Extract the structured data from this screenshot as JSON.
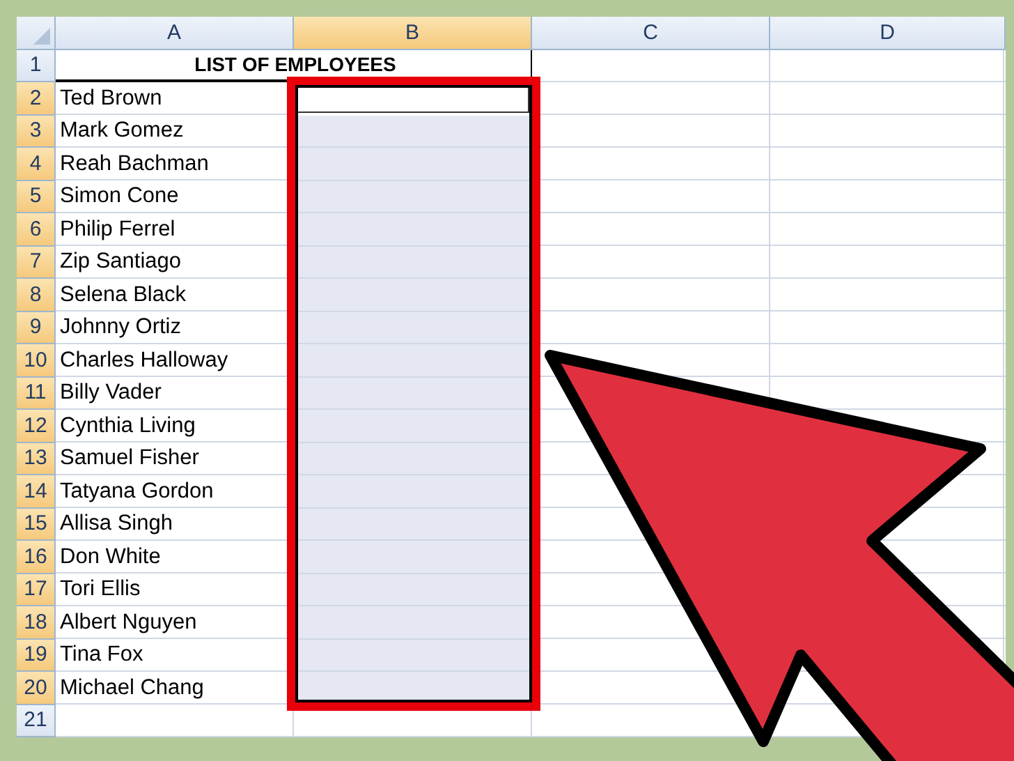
{
  "sheet": {
    "columns": [
      {
        "label": "A",
        "selected": false
      },
      {
        "label": "B",
        "selected": true
      },
      {
        "label": "C",
        "selected": false
      },
      {
        "label": "D",
        "selected": false
      }
    ],
    "rows": [
      {
        "label": "1",
        "kind": "title",
        "selected": false,
        "active": false,
        "text": "LIST OF EMPLOYEES"
      },
      {
        "label": "2",
        "kind": "name",
        "selected": true,
        "active": true,
        "text": "Ted Brown"
      },
      {
        "label": "3",
        "kind": "name",
        "selected": true,
        "active": false,
        "text": "Mark Gomez"
      },
      {
        "label": "4",
        "kind": "name",
        "selected": true,
        "active": false,
        "text": "Reah Bachman"
      },
      {
        "label": "5",
        "kind": "name",
        "selected": true,
        "active": false,
        "text": "Simon Cone"
      },
      {
        "label": "6",
        "kind": "name",
        "selected": true,
        "active": false,
        "text": "Philip Ferrel"
      },
      {
        "label": "7",
        "kind": "name",
        "selected": true,
        "active": false,
        "text": "Zip Santiago"
      },
      {
        "label": "8",
        "kind": "name",
        "selected": true,
        "active": false,
        "text": "Selena Black"
      },
      {
        "label": "9",
        "kind": "name",
        "selected": true,
        "active": false,
        "text": "Johnny Ortiz"
      },
      {
        "label": "10",
        "kind": "name",
        "selected": true,
        "active": false,
        "text": "Charles Halloway"
      },
      {
        "label": "11",
        "kind": "name",
        "selected": true,
        "active": false,
        "text": "Billy Vader"
      },
      {
        "label": "12",
        "kind": "name",
        "selected": true,
        "active": false,
        "text": "Cynthia Living"
      },
      {
        "label": "13",
        "kind": "name",
        "selected": true,
        "active": false,
        "text": "Samuel Fisher"
      },
      {
        "label": "14",
        "kind": "name",
        "selected": true,
        "active": false,
        "text": "Tatyana Gordon"
      },
      {
        "label": "15",
        "kind": "name",
        "selected": true,
        "active": false,
        "text": "Allisa Singh"
      },
      {
        "label": "16",
        "kind": "name",
        "selected": true,
        "active": false,
        "text": "Don White"
      },
      {
        "label": "17",
        "kind": "name",
        "selected": true,
        "active": false,
        "text": "Tori Ellis"
      },
      {
        "label": "18",
        "kind": "name",
        "selected": true,
        "active": false,
        "text": "Albert Nguyen"
      },
      {
        "label": "19",
        "kind": "name",
        "selected": true,
        "active": false,
        "text": "Tina Fox"
      },
      {
        "label": "20",
        "kind": "name",
        "selected": true,
        "active": false,
        "text": "Michael Chang"
      },
      {
        "label": "21",
        "kind": "empty",
        "selected": false,
        "active": false
      }
    ]
  }
}
